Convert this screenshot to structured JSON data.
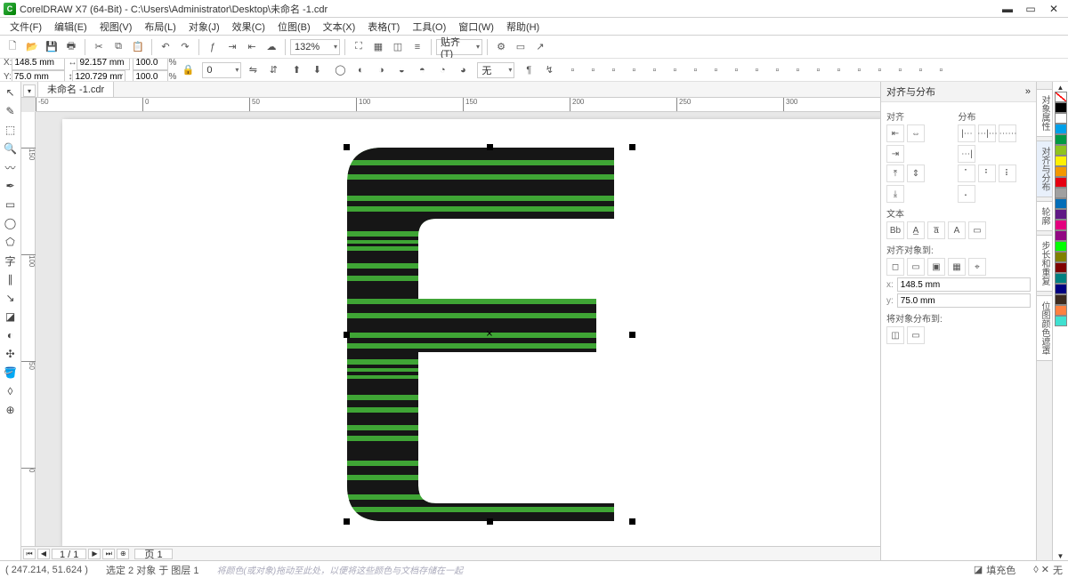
{
  "app": {
    "title": "CorelDRAW X7 (64-Bit) - C:\\Users\\Administrator\\Desktop\\未命名 -1.cdr"
  },
  "menu": [
    "文件(F)",
    "编辑(E)",
    "视图(V)",
    "布局(L)",
    "对象(J)",
    "效果(C)",
    "位图(B)",
    "文本(X)",
    "表格(T)",
    "工具(O)",
    "窗口(W)",
    "帮助(H)"
  ],
  "toolbar1": {
    "zoom": "132%",
    "snap_label": "贴齐(T)"
  },
  "props": {
    "x_label": "X:",
    "x": "148.5 mm",
    "y_label": "Y:",
    "y": "75.0 mm",
    "w_label": "↔",
    "w": "92.157 mm",
    "h_label": "↕",
    "h": "120.729 mm",
    "sx": "100.0",
    "sy": "100.0",
    "pct": "%",
    "angle": "0",
    "deg": "o",
    "none_label": "无"
  },
  "doc_tab": "未命名 -1.cdr",
  "ruler_ticks": [
    "-50",
    "0",
    "50",
    "100",
    "150",
    "200",
    "250",
    "300"
  ],
  "vruler_ticks": [
    "150",
    "100",
    "50",
    "0"
  ],
  "page_nav": {
    "page": "1 / 1",
    "tab": "页 1"
  },
  "right_panel": {
    "title": "对齐与分布",
    "align_label": "对齐",
    "dist_label": "分布",
    "text_label": "文本",
    "alignto_label": "对齐对象到:",
    "x_val": "148.5 mm",
    "y_val": "75.0 mm",
    "distto_label": "将对象分布到:"
  },
  "docker_tabs": [
    "对象属性",
    "对齐与分布",
    "轮廓",
    "步长和重复",
    "位图颜色遮罩"
  ],
  "colors": [
    "#000000",
    "#ffffff",
    "#00a0e9",
    "#009944",
    "#8fc31f",
    "#fff100",
    "#f39800",
    "#e60012",
    "#a0a0a0",
    "#036eb8",
    "#601986",
    "#e4007f",
    "#920783",
    "#00ff00",
    "#808000",
    "#800000",
    "#008080",
    "#000080",
    "#3d2b1f",
    "#ff8040",
    "#40e0d0"
  ],
  "status": {
    "coords": "( 247.214, 51.624 )",
    "selection": "选定 2 对象 于 图层 1",
    "hint": "将颜色(或对象)拖动至此处，以便将这些颜色与文档存储在一起",
    "fill_label": "填充色",
    "none_label": "无"
  }
}
